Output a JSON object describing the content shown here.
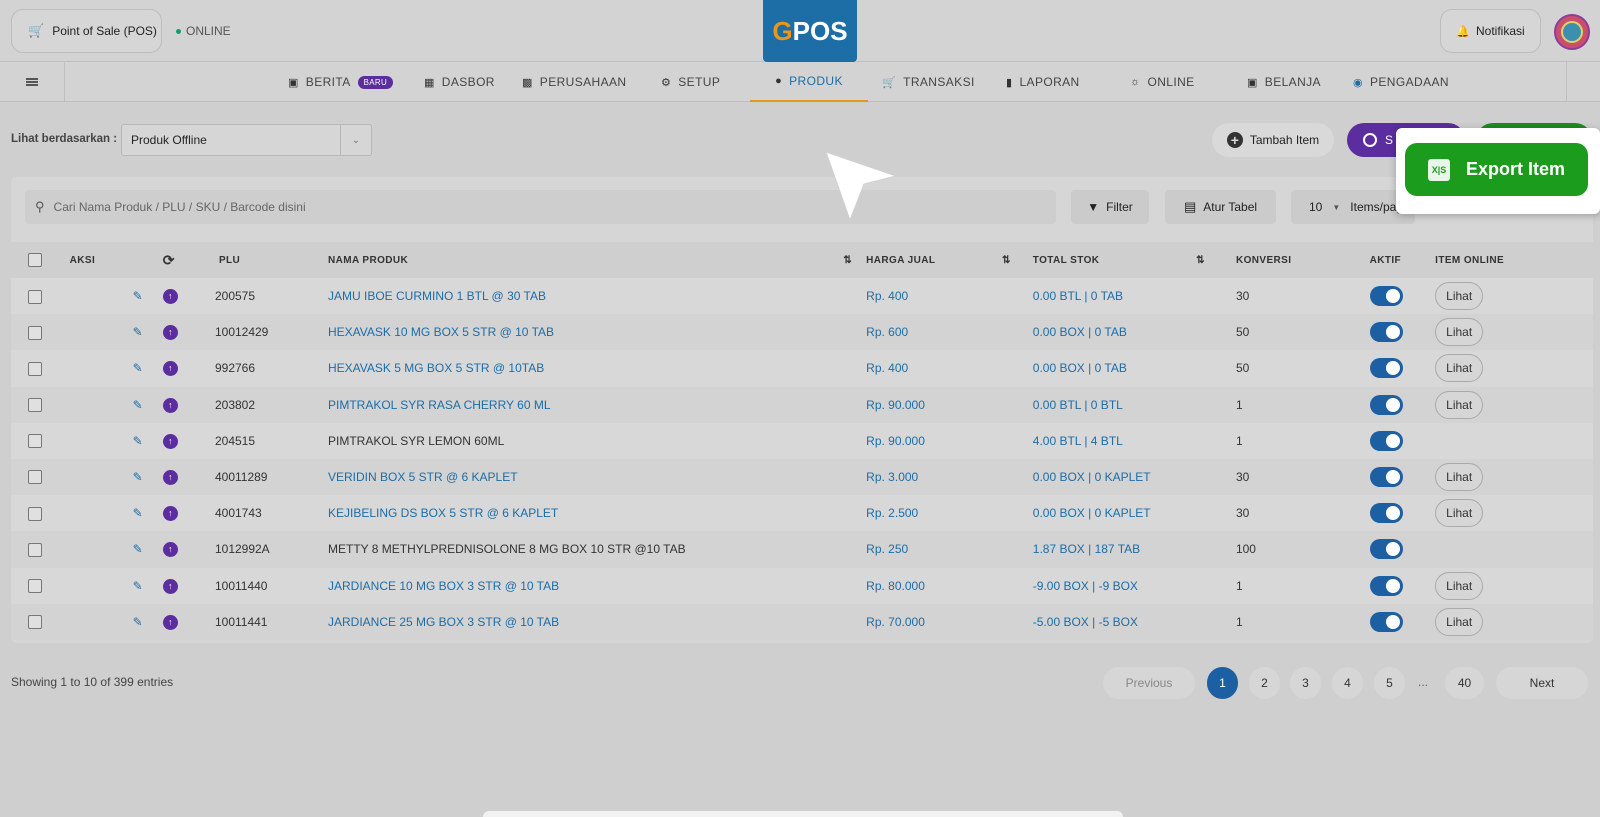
{
  "header": {
    "pos_label": "Point of Sale (POS)",
    "online_status": "ONLINE",
    "logo_g": "G",
    "logo_rest": "POS",
    "notification_label": "Notifikasi"
  },
  "nav": [
    {
      "label": "BERITA",
      "icon": "news-icon",
      "badge": "BARU"
    },
    {
      "label": "DASBOR",
      "icon": "dashboard-icon"
    },
    {
      "label": "PERUSAHAAN",
      "icon": "company-icon"
    },
    {
      "label": "SETUP",
      "icon": "gear-icon"
    },
    {
      "label": "PRODUK",
      "icon": "box-icon",
      "active": true
    },
    {
      "label": "TRANSAKSI",
      "icon": "cart-icon"
    },
    {
      "label": "LAPORAN",
      "icon": "report-icon"
    },
    {
      "label": "ONLINE",
      "icon": "globe-icon"
    },
    {
      "label": "BELANJA",
      "icon": "bag-icon"
    },
    {
      "label": "PENGADAAN",
      "icon": "procurement-icon"
    }
  ],
  "toolbar": {
    "view_label": "Lihat berdasarkan :",
    "view_value": "Produk Offline",
    "add_item": "Tambah Item",
    "sync_label": "S",
    "export_item": "Export Item"
  },
  "table_controls": {
    "search_placeholder": "Cari Nama Produk / PLU / SKU / Barcode disini",
    "filter": "Filter",
    "atur_tabel": "Atur Tabel",
    "per_page_value": "10",
    "per_page_label": "Items/page"
  },
  "table": {
    "headers": {
      "aksi": "AKSI",
      "plu": "PLU",
      "nama": "NAMA PRODUK",
      "harga": "HARGA JUAL",
      "stok": "TOTAL STOK",
      "konversi": "KONVERSI",
      "aktif": "AKTIF",
      "online": "ITEM ONLINE"
    },
    "view_btn": "Lihat",
    "rows": [
      {
        "plu": "200575",
        "name": "JAMU IBOE CURMINO 1 BTL @ 30 TAB",
        "price": "Rp. 400",
        "stock": "0.00 BTL | 0 TAB",
        "conv": "30",
        "link": true,
        "online": true
      },
      {
        "plu": "10012429",
        "name": "HEXAVASK 10 MG BOX 5 STR @ 10 TAB",
        "price": "Rp. 600",
        "stock": "0.00 BOX | 0 TAB",
        "conv": "50",
        "link": true,
        "online": true
      },
      {
        "plu": "992766",
        "name": "HEXAVASK 5 MG BOX 5 STR @ 10TAB",
        "price": "Rp. 400",
        "stock": "0.00 BOX | 0 TAB",
        "conv": "50",
        "link": true,
        "online": true
      },
      {
        "plu": "203802",
        "name": "PIMTRAKOL SYR RASA CHERRY 60 ML",
        "price": "Rp. 90.000",
        "stock": "0.00 BTL | 0 BTL",
        "conv": "1",
        "link": true,
        "online": true
      },
      {
        "plu": "204515",
        "name": "PIMTRAKOL SYR LEMON 60ML",
        "price": "Rp. 90.000",
        "stock": "4.00 BTL | 4 BTL",
        "conv": "1",
        "link": false,
        "online": false
      },
      {
        "plu": "40011289",
        "name": "VERIDIN BOX 5 STR @ 6 KAPLET",
        "price": "Rp. 3.000",
        "stock": "0.00 BOX | 0 KAPLET",
        "conv": "30",
        "link": true,
        "online": true
      },
      {
        "plu": "4001743",
        "name": "KEJIBELING DS BOX 5 STR @ 6 KAPLET",
        "price": "Rp. 2.500",
        "stock": "0.00 BOX | 0 KAPLET",
        "conv": "30",
        "link": true,
        "online": true
      },
      {
        "plu": "1012992A",
        "name": "METTY 8 METHYLPREDNISOLONE 8 MG BOX 10 STR @10 TAB",
        "price": "Rp. 250",
        "stock": "1.87 BOX | 187 TAB",
        "conv": "100",
        "link": false,
        "online": false
      },
      {
        "plu": "10011440",
        "name": "JARDIANCE 10 MG BOX 3 STR @ 10 TAB",
        "price": "Rp. 80.000",
        "stock": "-9.00 BOX | -9 BOX",
        "conv": "1",
        "link": true,
        "online": true
      },
      {
        "plu": "10011441",
        "name": "JARDIANCE 25 MG BOX 3 STR @ 10 TAB",
        "price": "Rp. 70.000",
        "stock": "-5.00 BOX | -5 BOX",
        "conv": "1",
        "link": true,
        "online": true
      }
    ]
  },
  "footer": {
    "showing": "Showing 1 to 10 of 399 entries",
    "previous": "Previous",
    "pages": [
      "1",
      "2",
      "3",
      "4",
      "5"
    ],
    "ellipsis": "...",
    "last_page": "40",
    "next": "Next"
  },
  "colors": {
    "primary": "#1d6da6",
    "accent": "#e9961a",
    "purple": "#5b2d9e",
    "green": "#1c9c1c"
  }
}
